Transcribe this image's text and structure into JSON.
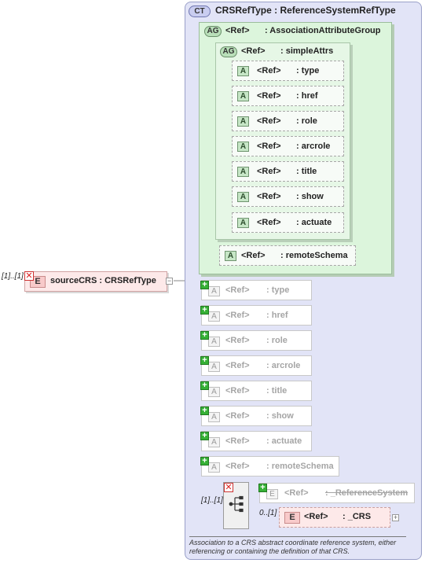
{
  "root": {
    "occurs": "[1]..[1]",
    "badge": "E",
    "label": "sourceCRS : CRSRefType"
  },
  "complex_type": {
    "badge": "CT",
    "title": "CRSRefType : ReferenceSystemRefType"
  },
  "association_group": {
    "badge": "AG",
    "ref": "<Ref>",
    "name": ": AssociationAttributeGroup"
  },
  "simple_attrs_group": {
    "badge": "AG",
    "ref": "<Ref>",
    "name": ": simpleAttrs"
  },
  "simple_attrs": [
    {
      "badge": "A",
      "ref": "<Ref>",
      "name": ": type"
    },
    {
      "badge": "A",
      "ref": "<Ref>",
      "name": ": href"
    },
    {
      "badge": "A",
      "ref": "<Ref>",
      "name": ": role"
    },
    {
      "badge": "A",
      "ref": "<Ref>",
      "name": ": arcrole"
    },
    {
      "badge": "A",
      "ref": "<Ref>",
      "name": ": title"
    },
    {
      "badge": "A",
      "ref": "<Ref>",
      "name": ": show"
    },
    {
      "badge": "A",
      "ref": "<Ref>",
      "name": ": actuate"
    }
  ],
  "remote_schema": {
    "badge": "A",
    "ref": "<Ref>",
    "name": ": remoteSchema"
  },
  "grey_attrs": [
    {
      "badge": "A",
      "ref": "<Ref>",
      "name": ": type"
    },
    {
      "badge": "A",
      "ref": "<Ref>",
      "name": ": href"
    },
    {
      "badge": "A",
      "ref": "<Ref>",
      "name": ": role"
    },
    {
      "badge": "A",
      "ref": "<Ref>",
      "name": ": arcrole"
    },
    {
      "badge": "A",
      "ref": "<Ref>",
      "name": ": title"
    },
    {
      "badge": "A",
      "ref": "<Ref>",
      "name": ": show"
    },
    {
      "badge": "A",
      "ref": "<Ref>",
      "name": ": actuate"
    },
    {
      "badge": "A",
      "ref": "<Ref>",
      "name": ": remoteSchema"
    }
  ],
  "choice": {
    "occurs": "[1]..[1]",
    "ref_system": {
      "badge": "E",
      "ref": "<Ref>",
      "name": ": _ReferenceSystem"
    },
    "crs": {
      "occurs": "0..[1]",
      "badge": "E",
      "ref": "<Ref>",
      "name": ": _CRS"
    }
  },
  "annotation": "Association to a CRS abstract coordinate reference system, either referencing or containing the definition of that CRS.",
  "colors": {
    "complex_type_bg": "#e2e4f7",
    "group_bg": "#dcf5dc",
    "element_bg": "#fde9e9",
    "expand_plus": "#36b036"
  }
}
